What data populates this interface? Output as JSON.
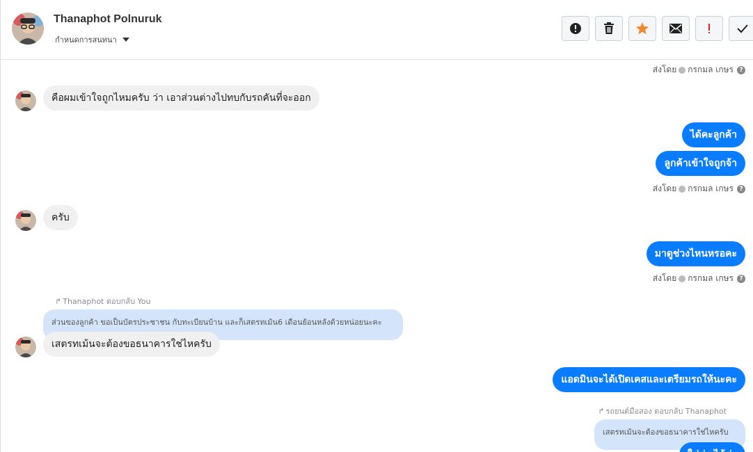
{
  "header": {
    "contact_name": "Thanaphot Polnuruk",
    "conversation_setting_label": "กำหนดการสนทนา",
    "toolbar": [
      {
        "icon": "alert-circle-icon",
        "label": "!"
      },
      {
        "icon": "trash-icon"
      },
      {
        "icon": "star-icon",
        "color": "#f2882d"
      },
      {
        "icon": "envelope-icon"
      },
      {
        "icon": "exclamation-icon",
        "label": "!",
        "color": "#e02020"
      },
      {
        "icon": "check-icon"
      }
    ]
  },
  "sent_by_meta": {
    "prefix": "ส่งโดย",
    "agent": "กรกมล เกษร",
    "help": "?"
  },
  "messages": [
    {
      "id": 1,
      "direction": "in",
      "text": "คือผมเข้าใจถูกไหมครับ ว่า เอาส่วนต่างไปทบกับรถคันที่จะออก"
    },
    {
      "id": 2,
      "direction": "out",
      "text": "ได้คะลูกค้า"
    },
    {
      "id": 3,
      "direction": "out",
      "text": "ลูกค้าเข้าใจถูกจ้า"
    },
    {
      "id": 4,
      "direction": "in",
      "text": "ครับ"
    },
    {
      "id": 5,
      "direction": "out",
      "text": "มาดูช่วงไหนหรอคะ"
    },
    {
      "id": 6,
      "direction": "in",
      "reply_label": "Thanaphot ตอบกลับ You",
      "quoted": "ส่วนของลูกค้า ขอเป็นบัตรประชาชน กับทะเบียนบ้าน และก็เสตรทเม้น6 เดือนย้อนหลังด้วยหน่อยนะคะ",
      "text": "เสตรทเม้นจะต้องขอธนาคารใช่ไหครับ"
    },
    {
      "id": 7,
      "direction": "out",
      "text": "แอดมินจะได้เปิดเคสและเตรียมรถให้นะคะ"
    },
    {
      "id": 8,
      "direction": "out",
      "reply_label": "รถยนต์มือสอง ตอบกลับ Thanaphot",
      "quoted": "เสตรทเม้นจะต้องขอธนาคารใช่ไหครับ",
      "text": "ใช่ค่ะ ได้ค่ะ"
    }
  ],
  "colors": {
    "outgoing_bubble": "#0a7cff",
    "incoming_bubble": "#f0f0f0",
    "quote_bubble": "#d3e4fb"
  }
}
